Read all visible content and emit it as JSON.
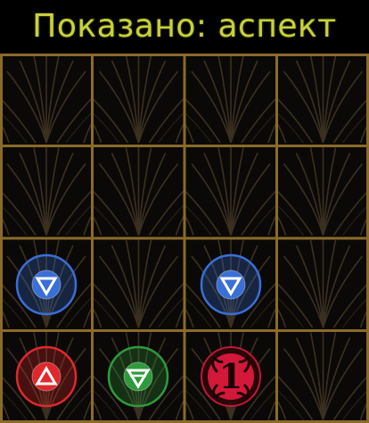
{
  "header": {
    "title": "Показано: аспект"
  },
  "board": {
    "rows": 4,
    "cols": 4,
    "cells": [
      {
        "row": 2,
        "col": 0,
        "token": "water",
        "color": "#3a6fd8"
      },
      {
        "row": 2,
        "col": 2,
        "token": "water",
        "color": "#3a6fd8"
      },
      {
        "row": 3,
        "col": 0,
        "token": "fire",
        "color": "#e0282c"
      },
      {
        "row": 3,
        "col": 1,
        "token": "earth",
        "color": "#2f9a3c"
      },
      {
        "row": 3,
        "col": 2,
        "token": "numbered",
        "color": "#d4183a",
        "number": "1"
      }
    ]
  },
  "colors": {
    "grid_line": "#8a6a2a",
    "title": "#c8d13a"
  }
}
